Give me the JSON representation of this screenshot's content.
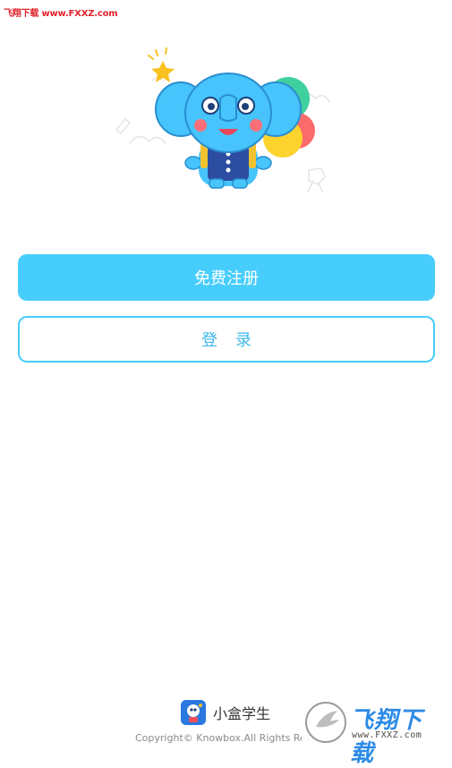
{
  "watermark": {
    "top_text": "飞翔下载 www.FXXZ.com",
    "bottom_logo_text": "飞翔下载",
    "bottom_url": "www.FXXZ.com"
  },
  "actions": {
    "register_label": "免费注册",
    "login_label": "登录"
  },
  "footer": {
    "app_name": "小盒学生",
    "copyright": "Copyright© Knowbox.All Rights Reserved"
  },
  "colors": {
    "accent": "#47cdfc",
    "login_text": "#3fb9e8",
    "watermark_red": "#e0212c"
  },
  "icons": {
    "mascot": "elephant-mascot-illustration",
    "app": "app-logo-icon",
    "watermark": "fxxz-logo-icon"
  }
}
